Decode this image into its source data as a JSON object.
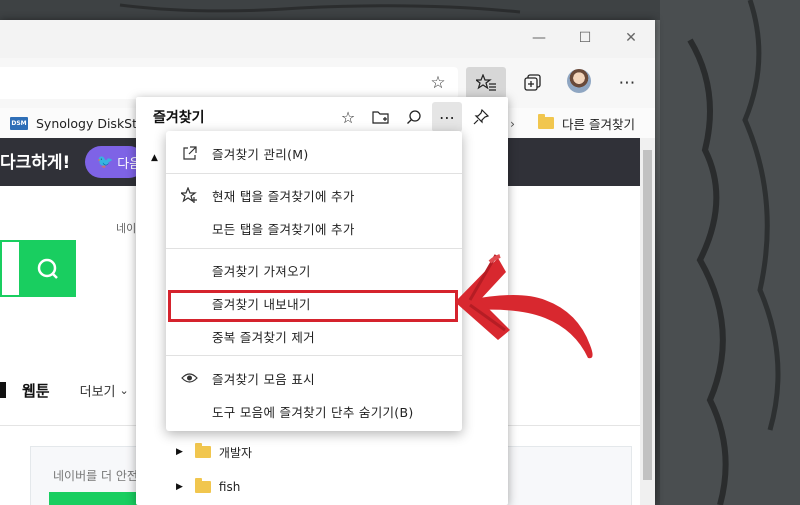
{
  "browser": {
    "favbar": {
      "items": [
        {
          "label": "Synology DiskStatio",
          "icon": "dsm-icon",
          "icon_text": "DSM"
        },
        {
          "label": "다른 즐겨찾기",
          "icon": "folder-icon"
        }
      ]
    }
  },
  "page": {
    "dark_banner_text": "다크하게!",
    "twitter_button_label": "다음",
    "small_text": "네이",
    "nav_tabs": [
      "웹툰",
      "더보기"
    ],
    "panel_text": "네이버를 더 안전"
  },
  "favorites_panel": {
    "title": "즐겨찾기",
    "tree": [
      {
        "label": "개발자"
      },
      {
        "label": "fish"
      }
    ]
  },
  "context_menu": {
    "items": [
      {
        "label": "즐겨찾기 관리(M)",
        "icon": "external-link-icon"
      },
      {
        "label": "현재 탭을 즐겨찾기에 추가",
        "icon": "star-plus-icon"
      },
      {
        "label": "모든 탭을 즐겨찾기에 추가",
        "icon": ""
      },
      {
        "label": "즐겨찾기 가져오기",
        "icon": ""
      },
      {
        "label": "즐겨찾기 내보내기",
        "icon": "",
        "highlighted": true
      },
      {
        "label": "중복 즐겨찾기 제거",
        "icon": ""
      },
      {
        "label": "즐겨찾기 모음 표시",
        "icon": "eye-icon"
      },
      {
        "label": "도구 모음에 즐겨찾기 단추 숨기기(B)",
        "icon": ""
      }
    ]
  },
  "colors": {
    "highlight": "#d5232d",
    "naver_green": "#19ce60",
    "dark_banner": "#303138",
    "twitter_purple": "#7e63e6"
  }
}
